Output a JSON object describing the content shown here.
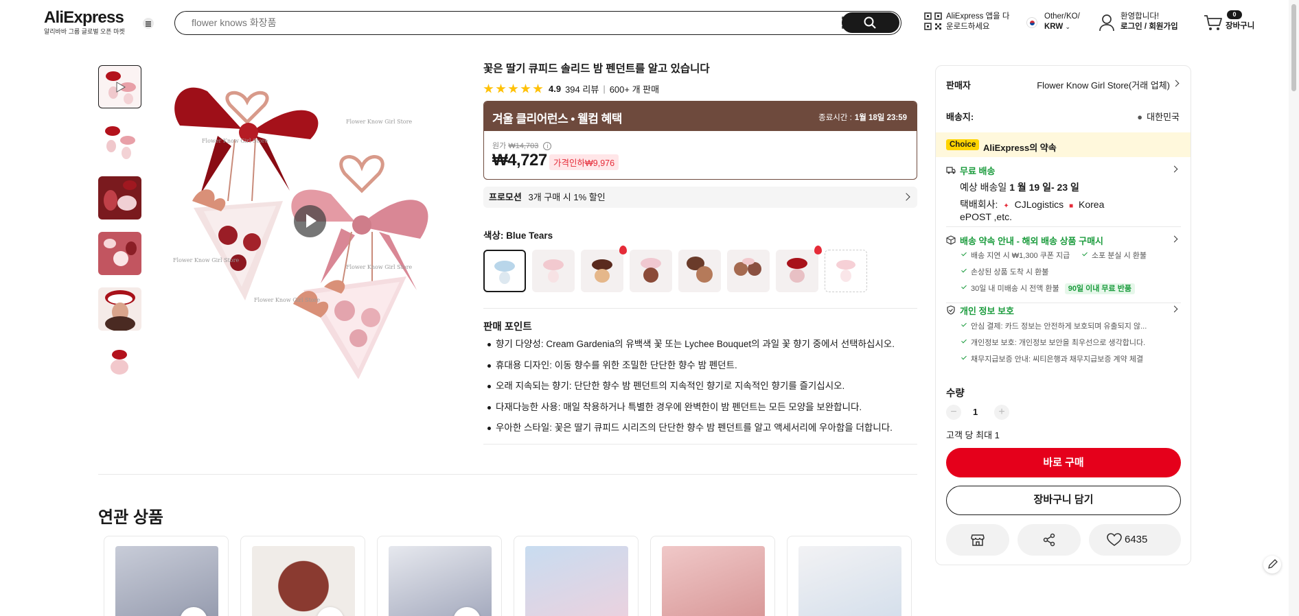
{
  "header": {
    "logo": "AliExpress",
    "logo_sub": "알리바바 그룹 글로벌 오픈 마켓",
    "search_placeholder": "flower knows 화장품",
    "app_promo_line1": "AliExpress 앱을 다",
    "app_promo_line2": "운로드하세요",
    "region_line1": "Other/KO/",
    "region_line2": "KRW",
    "user_line1": "환영합니다!",
    "user_line2": "로그인 / 회원가입",
    "cart_count": "0",
    "cart_label": "장바구니"
  },
  "product": {
    "title": "꽃은 딸기 큐피드 솔리드 밤 펜던트를 알고 있습니다",
    "rating": "4.9",
    "reviews": "394 리뷰",
    "sold": "600+ 개 판매",
    "promo_title": "겨울 클리어런스 • 웰컴 혜택",
    "promo_end_label": "종료시간 :",
    "promo_end_value": "1월 18일 23:59",
    "original_label": "원가",
    "original_price": "₩14,703",
    "price": "₩4,727",
    "discount": "가격인하₩9,976",
    "promotion_label": "프로모션",
    "promotion_text": "3개 구매 시 1% 할인",
    "color_label": "색상: Blue Tears",
    "selling_points_title": "판매 포인트",
    "selling_points": [
      "향기 다양성: Cream Gardenia의 유백색 꽃 또는 Lychee Bouquet의 과일 꽃 향기 중에서 선택하십시오.",
      "휴대용 디자인: 이동 향수를 위한 조밀한 단단한 향수 밤 펜던트.",
      "오래 지속되는 향기: 단단한 향수 밤 펜던트의 지속적인 향기로 지속적인 향기를 즐기십시오.",
      "다재다능한 사용: 매일 착용하거나 특별한 경우에 완벽한이 밤 펜던트는 모든 모양을 보완합니다.",
      "우아한 스타일: 꽃은 딸기 큐피드 시리즈의 단단한 향수 밤 펜던트를 알고 액세서리에 우아함을 더합니다."
    ],
    "watermark": "Flower Know Girl Store"
  },
  "related": {
    "title": "연관 상품"
  },
  "panel": {
    "seller_label": "판매자",
    "seller_value": "Flower Know Girl Store(거래 업체)",
    "shipto_label": "배송지:",
    "shipto_value": "대한민국",
    "choice_tag": "Choice",
    "choice_text": "AliExpress의 약속",
    "free_shipping": "무료 배송",
    "delivery_prefix": "예상 배송일",
    "delivery_date": "1 월 19 일- 23 일",
    "carrier_prefix": "택배회사:",
    "carrier_1": "CJLogistics",
    "carrier_2": "Korea",
    "carrier_3": "ePOST ,etc.",
    "guarantee_title": "배송 약속 안내 - 해외 배송 상품 구매시",
    "guarantee_items": [
      "배송 지연 시 ₩1,300 쿠폰 지급",
      "소포 분실 시 환불",
      "손상된 상품 도착 시 환불",
      "30일 내 미배송 시 전액 환불"
    ],
    "guarantee_badge": "90일 이내 무료 반품",
    "privacy_title": "개인 정보 보호",
    "privacy_items": [
      "안심 결제: 카드 정보는 안전하게 보호되며 유출되지 않...",
      "개인정보 보호: 개인정보 보안을 최우선으로 생각합니다.",
      "채무지급보증 안내: 씨티은행과 채무지급보증 계약 체결"
    ],
    "qty_label": "수량",
    "qty_value": "1",
    "qty_max": "고객 당 최대 1",
    "buy_now": "바로 구매",
    "add_to_cart": "장바구니 담기",
    "wishlist_count": "6435"
  },
  "colors": {
    "accent_red": "#e5001b",
    "promo_brown": "#6e4a3d",
    "green": "#1a9b3c",
    "star": "#ffc107"
  }
}
